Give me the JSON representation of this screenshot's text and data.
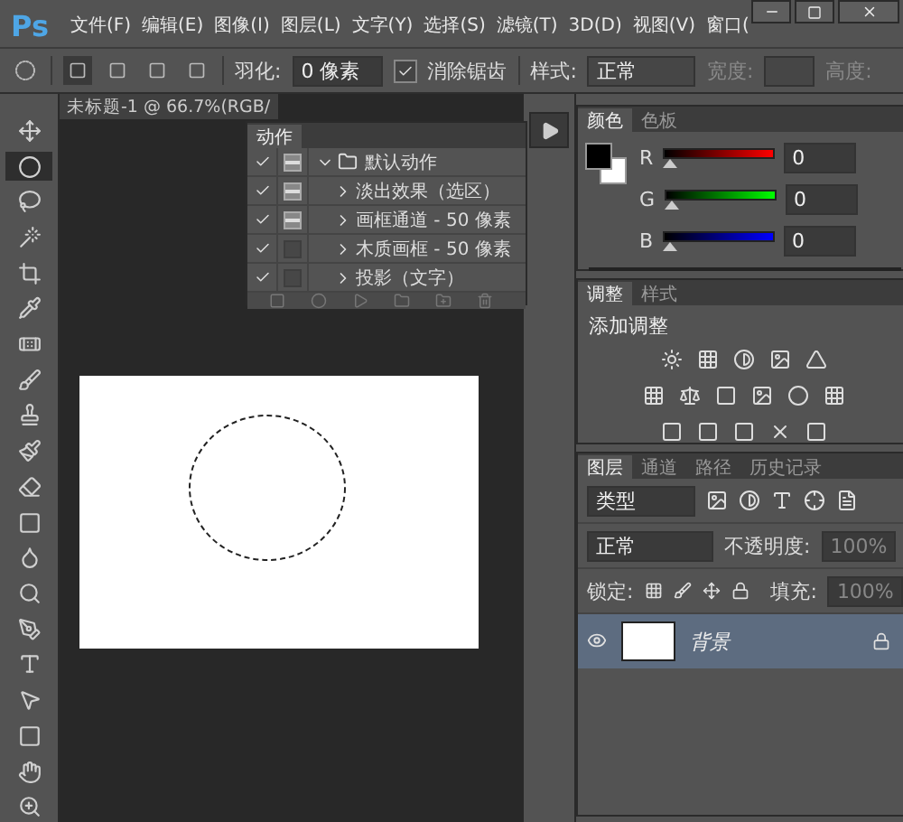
{
  "app": {
    "logo": "Ps"
  },
  "menu": [
    "文件(F)",
    "编辑(E)",
    "图像(I)",
    "图层(L)",
    "文字(Y)",
    "选择(S)",
    "滤镜(T)",
    "3D(D)",
    "视图(V)",
    "窗口("
  ],
  "options_bar": {
    "feather_label": "羽化:",
    "feather_value": "0 像素",
    "antialias": {
      "label": "消除锯齿",
      "checked": true
    },
    "style_label": "样式:",
    "style_value": "正常",
    "width_label": "宽度:",
    "height_label": "高度:"
  },
  "document_tab": {
    "title": "未标题-1 @ 66.7%(RGB/"
  },
  "actions_panel": {
    "tab": "动作",
    "actions": [
      {
        "label": "默认动作",
        "checked": true,
        "dialog": true,
        "expanded": true,
        "children": [
          {
            "label": "淡出效果（选区）",
            "checked": true,
            "dialog": true,
            "expanded": false
          },
          {
            "label": "画框通道 - 50 像素",
            "checked": true,
            "dialog": true,
            "expanded": false
          },
          {
            "label": "木质画框 - 50 像素",
            "checked": true,
            "dialog": false,
            "expanded": false
          },
          {
            "label": "投影（文字）",
            "checked": true,
            "dialog": false,
            "expanded": false
          }
        ]
      }
    ]
  },
  "color_panel": {
    "tabs": [
      {
        "label": "颜色",
        "selected": true
      },
      {
        "label": "色板",
        "selected": false
      }
    ],
    "channels": [
      {
        "label": "R",
        "value": "0",
        "level": 0
      },
      {
        "label": "G",
        "value": "0",
        "level": 0
      },
      {
        "label": "B",
        "value": "0",
        "level": 0
      }
    ]
  },
  "adjustments_panel": {
    "tabs": [
      {
        "label": "调整",
        "selected": true
      },
      {
        "label": "样式",
        "selected": false
      }
    ],
    "title": "添加调整"
  },
  "layers_panel": {
    "tabs": [
      {
        "label": "图层",
        "selected": true
      },
      {
        "label": "通道",
        "selected": false
      },
      {
        "label": "路径",
        "selected": false
      },
      {
        "label": "历史记录",
        "selected": false
      }
    ],
    "filter": "类型",
    "blend_mode": "正常",
    "opacity_label": "不透明度:",
    "opacity": "100%",
    "lock_label": "锁定:",
    "fill_label": "填充:",
    "fill": "100%",
    "layers": [
      {
        "name": "背景",
        "visible": true,
        "selected": true,
        "locked": true
      }
    ]
  }
}
